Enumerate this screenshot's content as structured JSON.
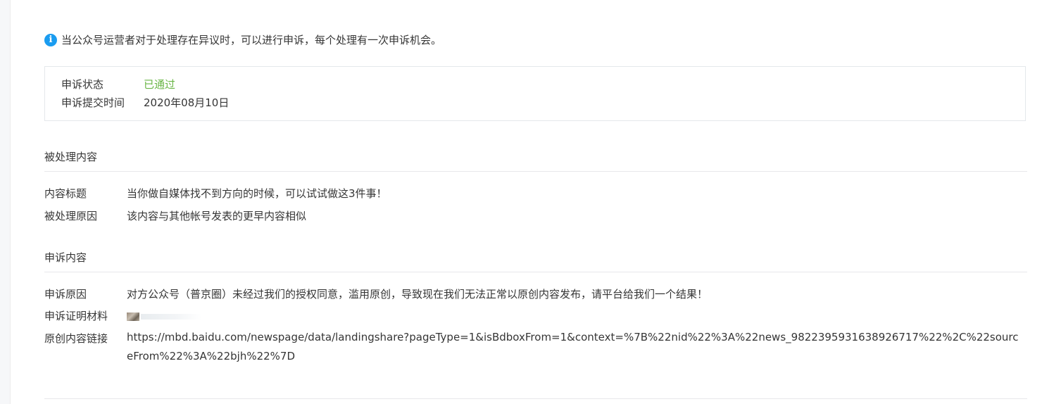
{
  "notice": {
    "icon": "info-icon",
    "text": "当公众号运营者对于处理存在异议时，可以进行申诉，每个处理有一次申诉机会。"
  },
  "status": {
    "state_label": "申诉状态",
    "state_value": "已通过",
    "state_color": "#6ab646",
    "time_label": "申诉提交时间",
    "time_value": "2020年08月10日"
  },
  "processed": {
    "title": "被处理内容",
    "content_title_label": "内容标题",
    "content_title_value": "当你做自媒体找不到方向的时候，可以试试做这3件事！",
    "reason_label": "被处理原因",
    "reason_value": "该内容与其他帐号发表的更早内容相似"
  },
  "appeal": {
    "title": "申诉内容",
    "reason_label": "申诉原因",
    "reason_value": "对方公众号（普京圈）未经过我们的授权同意，滥用原创，导致现在我们无法正常以原创内容发布，请平台给我们一个结果！",
    "evidence_label": "申诉证明材料",
    "link_label": "原创内容链接",
    "link_value": "https://mbd.baidu.com/newspage/data/landingshare?pageType=1&isBdboxFrom=1&context=%7B%22nid%22%3A%22news_9822395931638926717%22%2C%22sourceFrom%22%3A%22bjh%22%7D"
  }
}
